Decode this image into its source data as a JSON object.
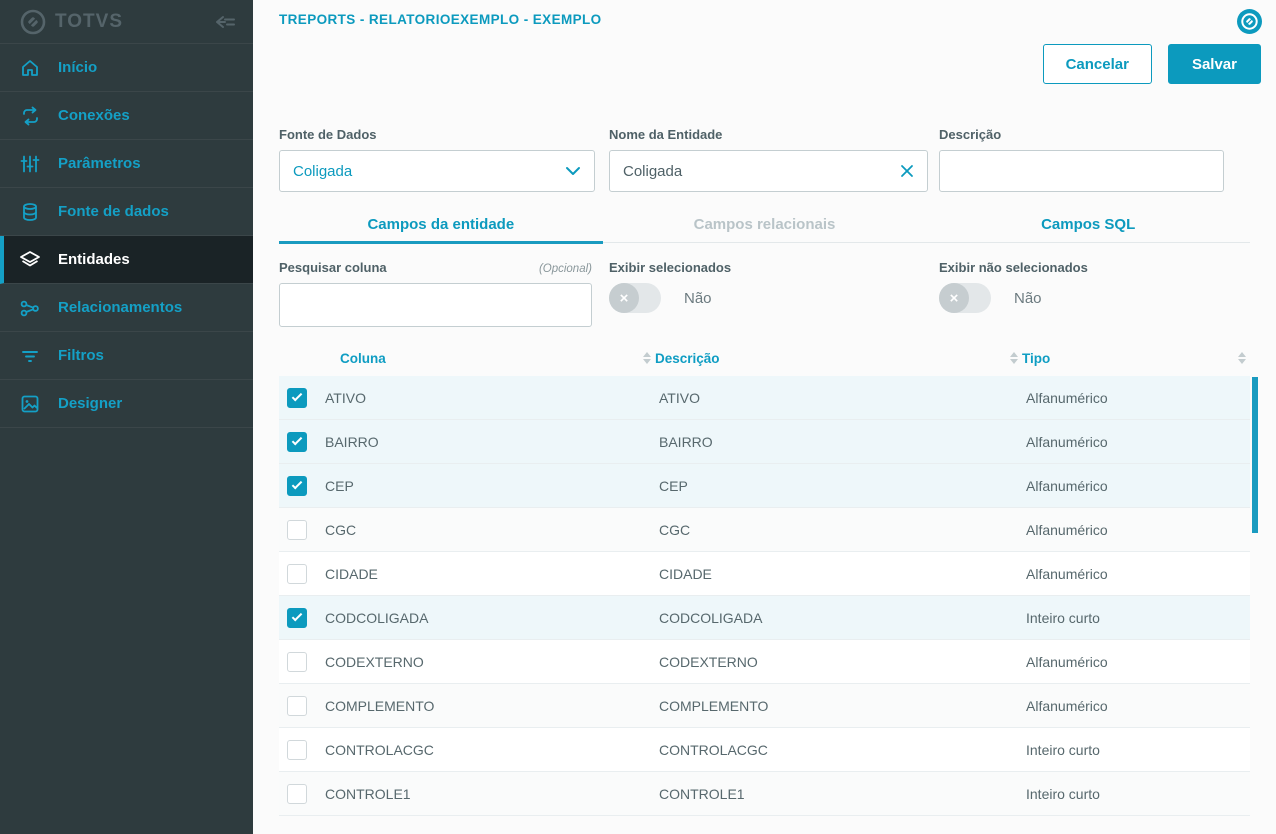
{
  "colors": {
    "accent": "#0c9abe",
    "sidebar_bg": "#2e3b3e",
    "row_checked_bg": "#eef7fa"
  },
  "sidebar": {
    "logo_text": "TOTVS",
    "items": [
      {
        "label": "Início",
        "icon": "home-icon",
        "active": false
      },
      {
        "label": "Conexões",
        "icon": "connections-icon",
        "active": false
      },
      {
        "label": "Parâmetros",
        "icon": "sliders-icon",
        "active": false
      },
      {
        "label": "Fonte de dados",
        "icon": "database-icon",
        "active": false
      },
      {
        "label": "Entidades",
        "icon": "layers-icon",
        "active": true
      },
      {
        "label": "Relacionamentos",
        "icon": "share-icon",
        "active": false
      },
      {
        "label": "Filtros",
        "icon": "filter-icon",
        "active": false
      },
      {
        "label": "Designer",
        "icon": "image-icon",
        "active": false
      }
    ]
  },
  "header": {
    "title": "TREPORTS - RELATORIOEXEMPLO - EXEMPLO"
  },
  "actions": {
    "cancel_label": "Cancelar",
    "save_label": "Salvar"
  },
  "form": {
    "fonte_de_dados": {
      "label": "Fonte de Dados",
      "value": "Coligada"
    },
    "nome_da_entidade": {
      "label": "Nome da Entidade",
      "value": "Coligada"
    },
    "descricao": {
      "label": "Descrição",
      "value": ""
    }
  },
  "tabs": [
    {
      "label": "Campos da entidade",
      "state": "active"
    },
    {
      "label": "Campos relacionais",
      "state": "disabled"
    },
    {
      "label": "Campos SQL",
      "state": "normal"
    }
  ],
  "filters": {
    "search": {
      "label": "Pesquisar coluna",
      "optional_label": "(Opcional)",
      "value": ""
    },
    "show_selected": {
      "label": "Exibir selecionados",
      "value": "Não",
      "on": false
    },
    "show_unselected": {
      "label": "Exibir não selecionados",
      "value": "Não",
      "on": false
    }
  },
  "table": {
    "columns": [
      "Coluna",
      "Descrição",
      "Tipo"
    ],
    "rows": [
      {
        "checked": true,
        "coluna": "ATIVO",
        "descricao": "ATIVO",
        "tipo": "Alfanumérico"
      },
      {
        "checked": true,
        "coluna": "BAIRRO",
        "descricao": "BAIRRO",
        "tipo": "Alfanumérico"
      },
      {
        "checked": true,
        "coluna": "CEP",
        "descricao": "CEP",
        "tipo": "Alfanumérico"
      },
      {
        "checked": false,
        "coluna": "CGC",
        "descricao": "CGC",
        "tipo": "Alfanumérico"
      },
      {
        "checked": false,
        "coluna": "CIDADE",
        "descricao": "CIDADE",
        "tipo": "Alfanumérico"
      },
      {
        "checked": true,
        "coluna": "CODCOLIGADA",
        "descricao": "CODCOLIGADA",
        "tipo": "Inteiro curto"
      },
      {
        "checked": false,
        "coluna": "CODEXTERNO",
        "descricao": "CODEXTERNO",
        "tipo": "Alfanumérico"
      },
      {
        "checked": false,
        "coluna": "COMPLEMENTO",
        "descricao": "COMPLEMENTO",
        "tipo": "Alfanumérico"
      },
      {
        "checked": false,
        "coluna": "CONTROLACGC",
        "descricao": "CONTROLACGC",
        "tipo": "Inteiro curto"
      },
      {
        "checked": false,
        "coluna": "CONTROLE1",
        "descricao": "CONTROLE1",
        "tipo": "Inteiro curto"
      }
    ]
  }
}
